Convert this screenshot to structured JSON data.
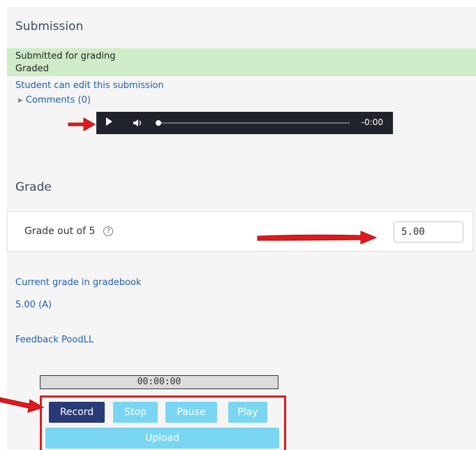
{
  "submission": {
    "title": "Submission",
    "status_submitted": "Submitted for grading",
    "status_graded": "Graded",
    "edit_note": "Student can edit this submission",
    "comments_label": "Comments (0)",
    "audio_time": "-0:00"
  },
  "grade": {
    "title": "Grade",
    "grade_out_of_label": "Grade out of 5",
    "help_glyph": "?",
    "grade_value": "5.00",
    "current_grade_label": "Current grade in gradebook",
    "current_grade_value": "5.00 (A)",
    "feedback_label": "Feedback PoodLL"
  },
  "recorder": {
    "timer": "00:00:00",
    "record_label": "Record",
    "stop_label": "Stop",
    "pause_label": "Pause",
    "play_label": "Play",
    "upload_label": "Upload"
  },
  "icons": {
    "play": "play-icon",
    "volume": "volume-icon",
    "help": "help-icon",
    "expand": "triangle-right-icon",
    "annotation": "red-arrow-icon"
  },
  "colors": {
    "status_band": "#cfecc9",
    "link": "#1f5fad",
    "record_button": "#283a78",
    "light_button": "#79d6f2",
    "annotation_red": "#e1191e"
  }
}
